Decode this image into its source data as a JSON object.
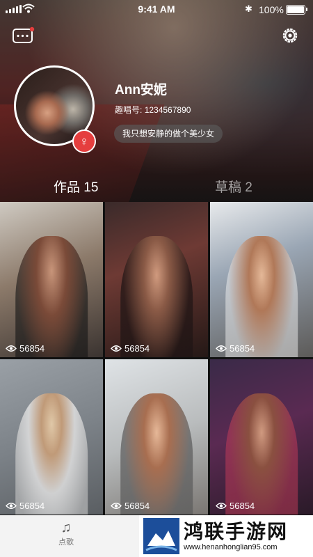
{
  "status_bar": {
    "time": "9:41 AM",
    "battery": "100%"
  },
  "profile": {
    "name": "Ann安妮",
    "id_label": "趣唱号:",
    "id_value": "1234567890",
    "bio": "我只想安静的做个美少女",
    "gender": "female"
  },
  "tabs": [
    {
      "label": "作品 15",
      "active": true
    },
    {
      "label": "草稿 2",
      "active": false
    }
  ],
  "works": [
    {
      "views": "56854"
    },
    {
      "views": "56854"
    },
    {
      "views": "56854"
    },
    {
      "views": "56854"
    },
    {
      "views": "56854"
    },
    {
      "views": "56854"
    }
  ],
  "bottom_nav": [
    {
      "label": "点歌",
      "icon": "music-note-icon"
    }
  ],
  "watermark": {
    "title": "鸿联手游网",
    "url": "www.henanhonglian95.com"
  },
  "colors": {
    "accent_red": "#e53e3e",
    "bottom_bar": "#f3f3f3"
  }
}
